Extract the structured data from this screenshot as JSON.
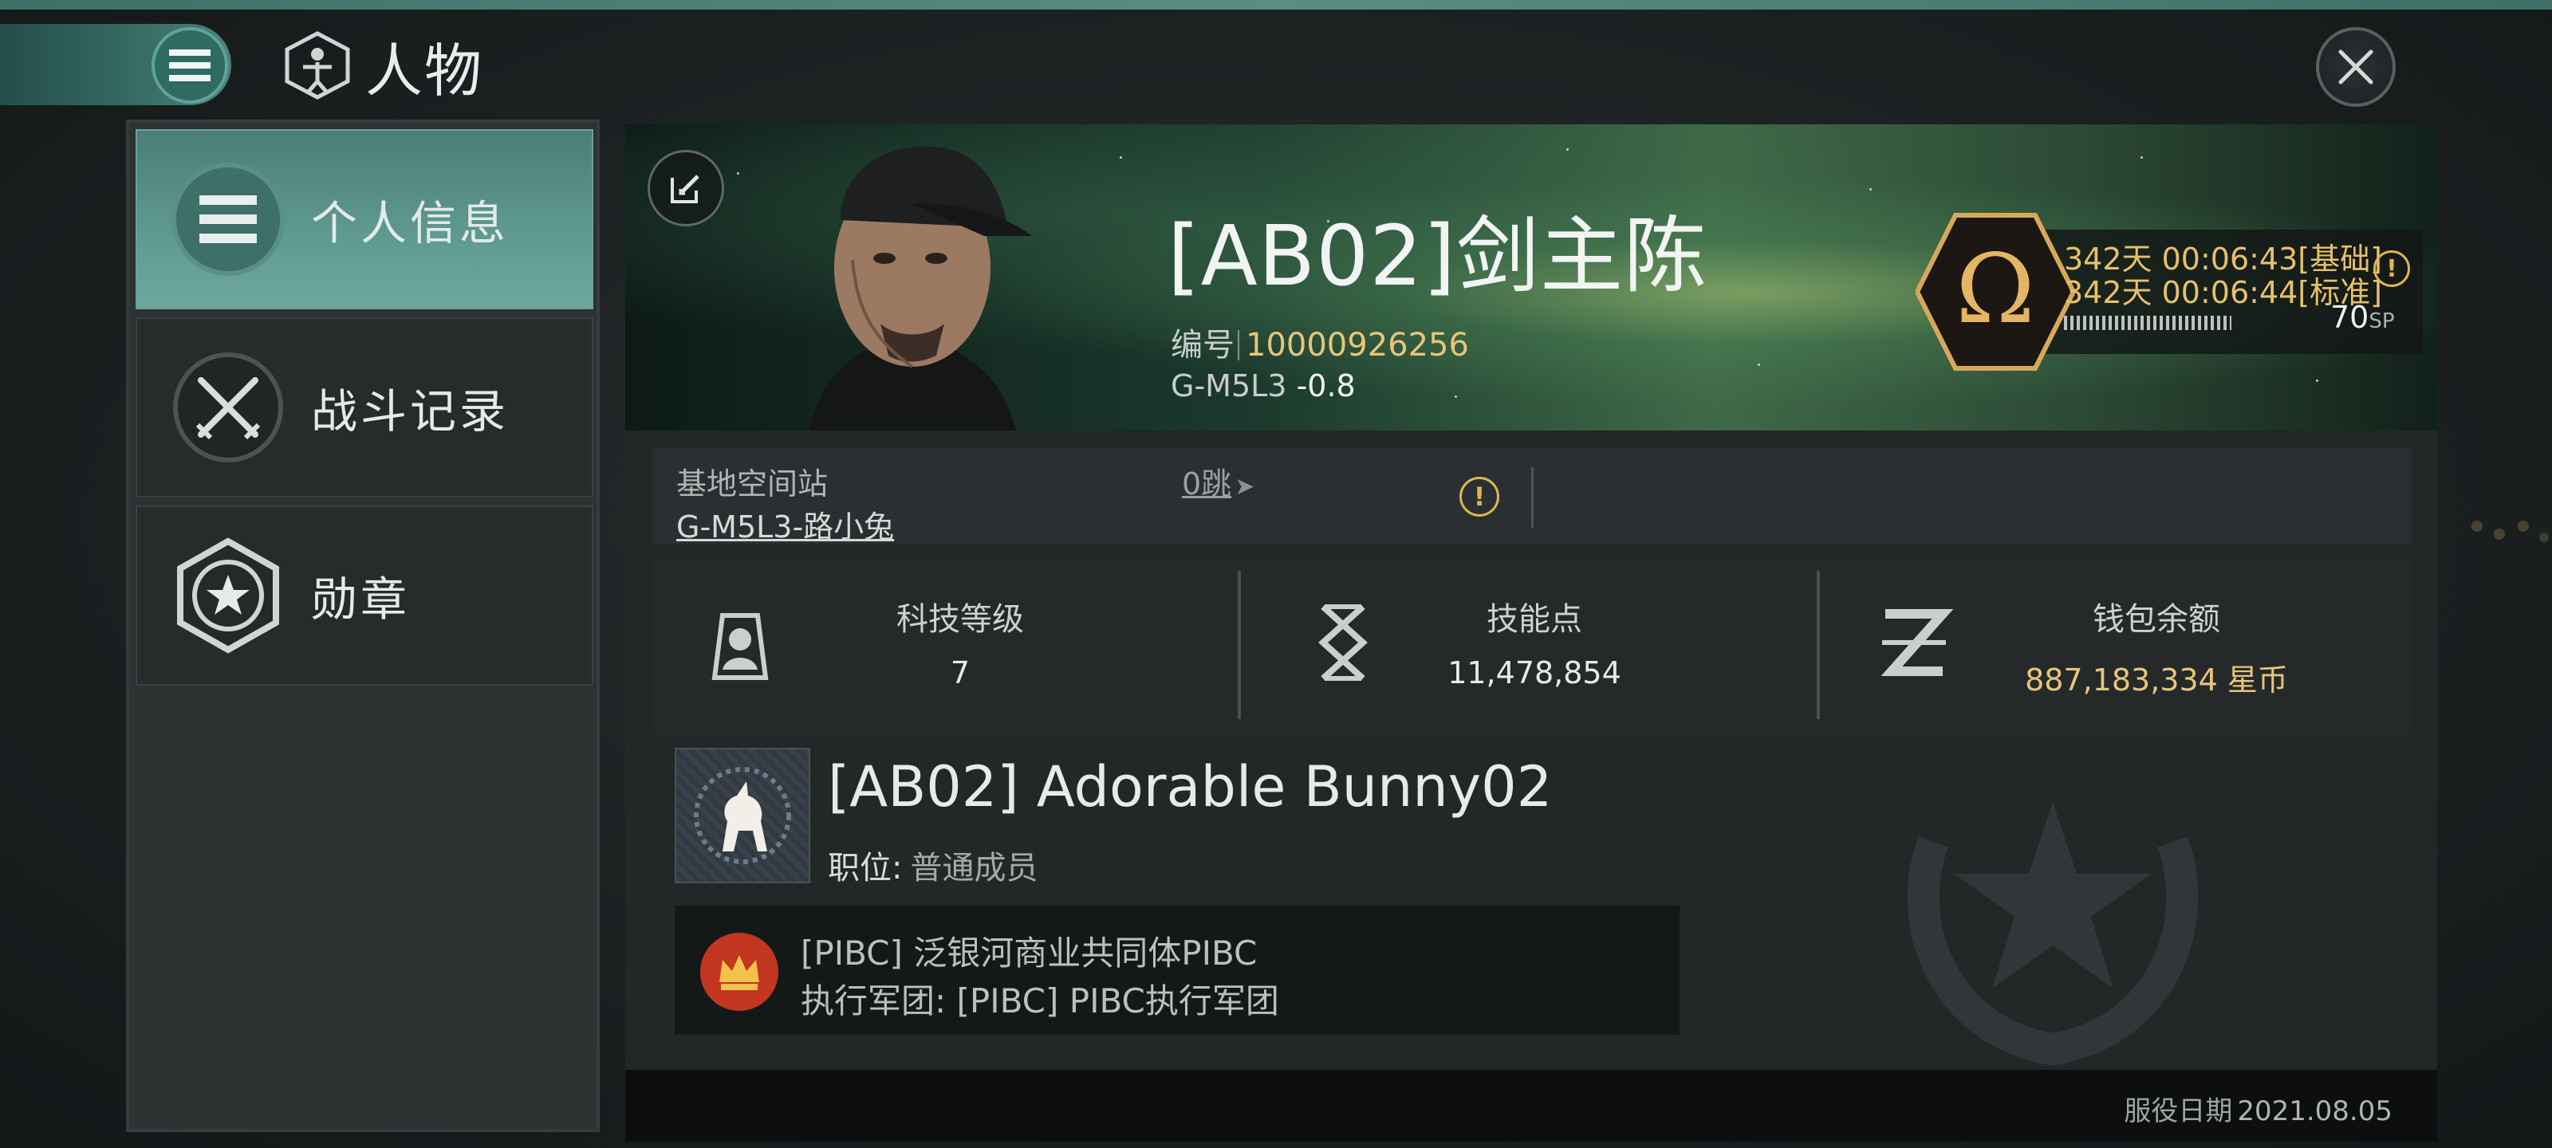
{
  "header": {
    "title": "人物"
  },
  "sidebar": {
    "items": [
      {
        "label": "个人信息",
        "active": true
      },
      {
        "label": "战斗记录",
        "active": false
      },
      {
        "label": "勋章",
        "active": false
      }
    ]
  },
  "profile": {
    "name": "[AB02]剑主陈",
    "id_label": "编号",
    "id_value": "10000926256",
    "location": "G-M5L3",
    "security": "-0.8",
    "omega": {
      "line1": "342天 00:06:43[基础]",
      "line2": "342天 00:06:44[标准]",
      "sp_value": "70",
      "sp_unit": "SP"
    }
  },
  "station": {
    "label": "基地空间站",
    "name": "G-M5L3-路小兔",
    "jumps": "0跳"
  },
  "stats": [
    {
      "label": "科技等级",
      "value": "7",
      "icon": "tech-level-icon"
    },
    {
      "label": "技能点",
      "value": "11,478,854",
      "icon": "skill-points-icon"
    },
    {
      "label": "钱包余额",
      "value": "887,183,334 星币",
      "icon": "wallet-icon"
    }
  ],
  "corporation": {
    "name": "[AB02] Adorable Bunny02",
    "role_label": "职位:",
    "role_value": "普通成员",
    "alliance_name": "[PIBC] 泛银河商业共同体PIBC",
    "alliance_army": "执行军团: [PIBC] PIBC执行军团"
  },
  "footer": {
    "service_label": "服役日期",
    "service_date": "2021.08.05"
  },
  "colors": {
    "accent_teal": "#4d8279",
    "gold": "#e8c57a",
    "panel": "#222728"
  }
}
